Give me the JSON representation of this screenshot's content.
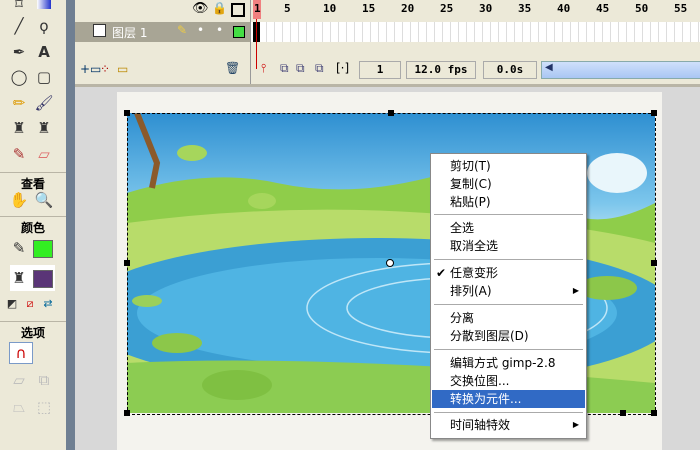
{
  "toolbar": {
    "view_label": "查看",
    "colors_label": "颜色",
    "options_label": "选项",
    "stroke_color": "#33ee22",
    "fill_color": "#5a3577"
  },
  "timeline": {
    "layer_name": "图层 1",
    "frame_numbers": [
      "1",
      "5",
      "10",
      "15",
      "20",
      "25",
      "30",
      "35",
      "40",
      "45",
      "50",
      "55"
    ],
    "current_frame": "1",
    "fps": "12.0 fps",
    "time": "0.0s",
    "layer_color": "#44dd44"
  },
  "context_menu": {
    "items": [
      {
        "label": "剪切(T)"
      },
      {
        "label": "复制(C)"
      },
      {
        "label": "粘贴(P)"
      },
      {
        "label": "全选"
      },
      {
        "label": "取消全选"
      },
      {
        "label": "任意变形",
        "checked": true
      },
      {
        "label": "排列(A)",
        "submenu": true
      },
      {
        "label": "分离"
      },
      {
        "label": "分散到图层(D)"
      },
      {
        "label": "编辑方式 gimp-2.8"
      },
      {
        "label": "交换位图..."
      },
      {
        "label": "转换为元件...",
        "highlighted": true
      },
      {
        "label": "时间轴特效",
        "submenu": true
      }
    ]
  }
}
